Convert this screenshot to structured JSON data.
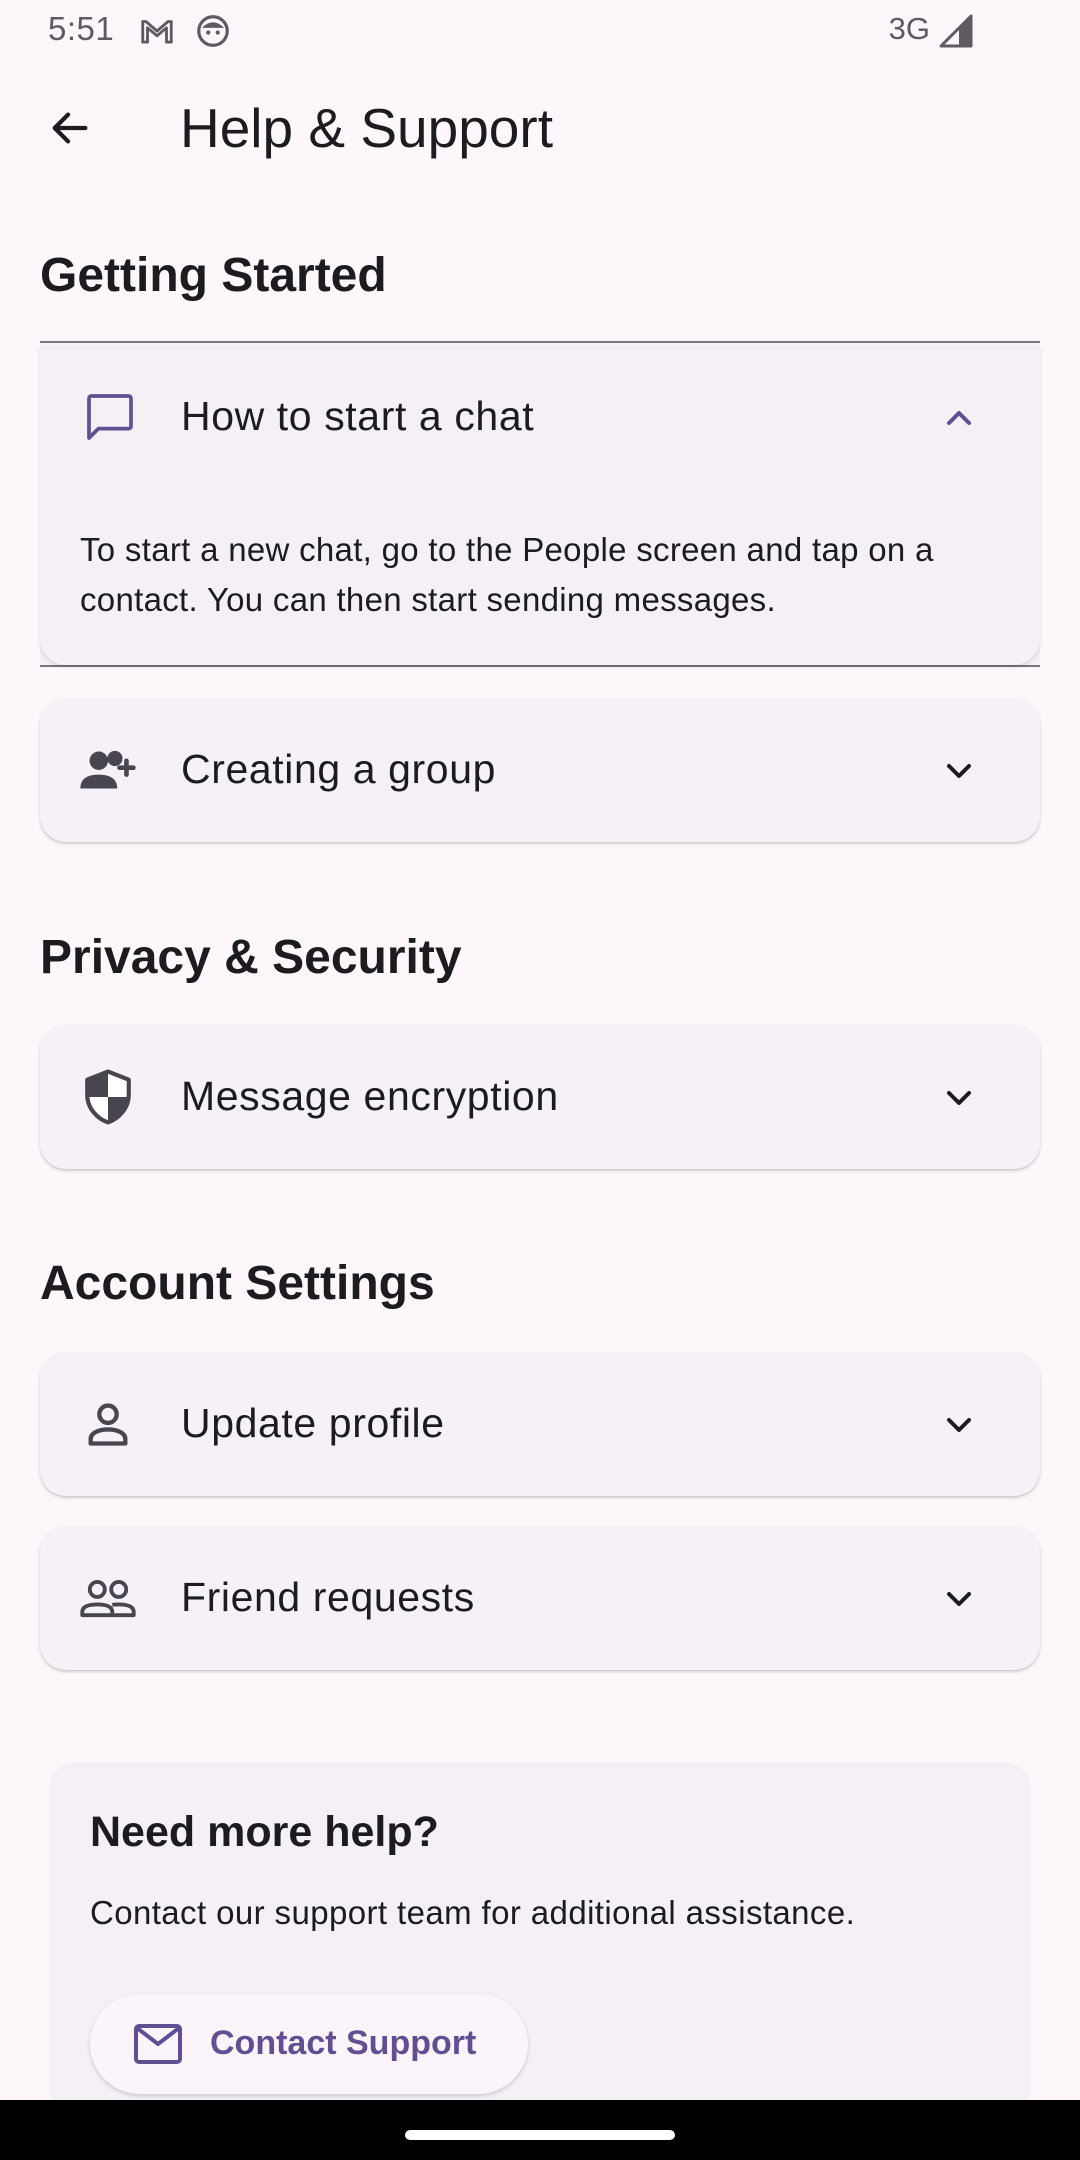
{
  "status_bar": {
    "time": "5:51",
    "network": "3G",
    "icons": [
      "gmail-icon",
      "face-icon",
      "signal-icon"
    ]
  },
  "app_bar": {
    "title": "Help & Support",
    "back_icon": "arrow-back-icon"
  },
  "sections": [
    {
      "heading": "Getting Started",
      "items": [
        {
          "title": "How to start a chat",
          "icon": "chat-bubble-icon",
          "expanded": true,
          "answer": "To start a new chat, go to the People screen and tap on a contact. You can then start sending messages."
        },
        {
          "title": "Creating a group",
          "icon": "group-add-icon",
          "expanded": false
        }
      ]
    },
    {
      "heading": "Privacy & Security",
      "items": [
        {
          "title": "Message encryption",
          "icon": "shield-icon",
          "expanded": false
        }
      ]
    },
    {
      "heading": "Account Settings",
      "items": [
        {
          "title": "Update profile",
          "icon": "person-icon",
          "expanded": false
        },
        {
          "title": "Friend requests",
          "icon": "people-icon",
          "expanded": false
        }
      ]
    }
  ],
  "help_card": {
    "title": "Need more help?",
    "description": "Contact our support team for additional assistance.",
    "button_label": "Contact Support",
    "button_icon": "mail-icon"
  },
  "colors": {
    "background": "#fdf7fc",
    "card": "#f6f0f7",
    "accent": "#5f5093",
    "text": "#1c1b1f"
  }
}
